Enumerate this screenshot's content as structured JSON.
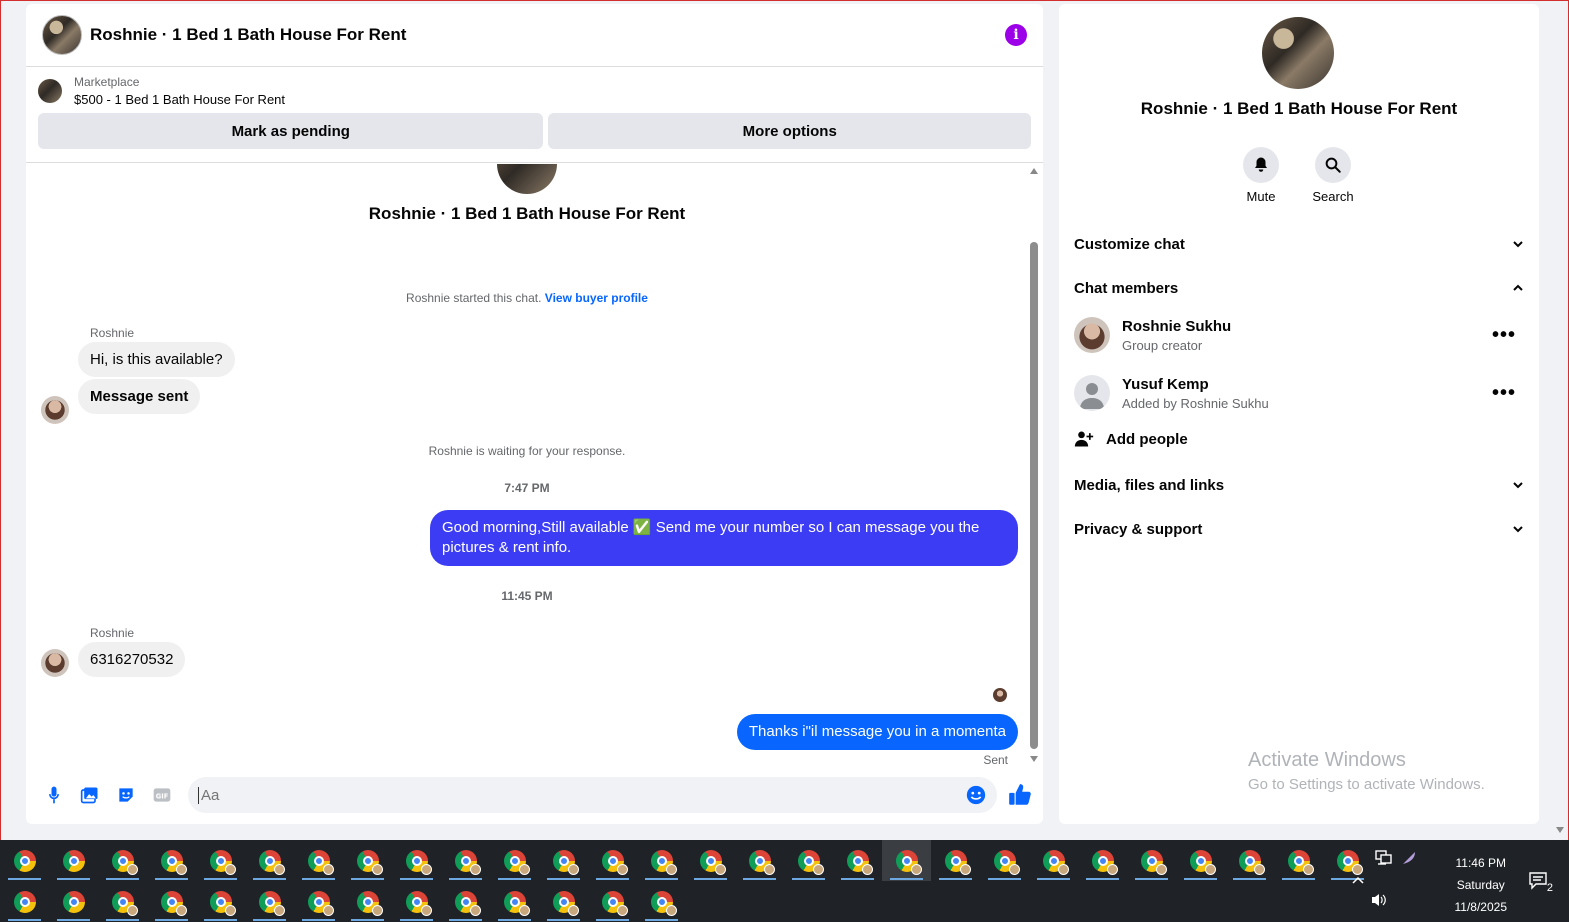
{
  "chat": {
    "header_title": "Roshnie · 1 Bed 1 Bath House For Rent",
    "info_icon": "info-icon",
    "marketplace": {
      "source": "Marketplace",
      "item": "$500 - 1 Bed 1 Bath House For Rent",
      "mark_pending": "Mark as pending",
      "more_options": "More options"
    },
    "convo_title": "Roshnie · 1 Bed 1 Bath House For Rent",
    "started": "Roshnie started this chat.",
    "view_profile": "View buyer profile",
    "messages": [
      {
        "sender": "Roshnie",
        "text": "Hi, is this available?"
      },
      {
        "text": "Message sent"
      }
    ],
    "waiting": "Roshnie is waiting for your response.",
    "time1": "7:47 PM",
    "out1_line1": "Good morning,Still available ✅ Send me your number so I can message you the",
    "out1_line2": "pictures & rent info.",
    "time2": "11:45 PM",
    "sender2": "Roshnie",
    "in3": "6316270532",
    "out2": "Thanks i\"il message you in a momenta",
    "sent_status": "Sent",
    "composer_placeholder": "Aa"
  },
  "info": {
    "title": "Roshnie · 1 Bed 1 Bath House For Rent",
    "mute": "Mute",
    "search": "Search",
    "customize": "Customize chat",
    "members_header": "Chat members",
    "members": [
      {
        "name": "Roshnie Sukhu",
        "sub": "Group creator"
      },
      {
        "name": "Yusuf Kemp",
        "sub": "Added by Roshnie Sukhu"
      }
    ],
    "add_people": "Add people",
    "media": "Media, files and links",
    "privacy": "Privacy & support"
  },
  "watermark": {
    "line1": "Activate Windows",
    "line2": "Go to Settings to activate Windows."
  },
  "taskbar": {
    "time": "11:46 PM",
    "day": "Saturday",
    "date": "11/8/2025",
    "notifications": "2"
  },
  "colors": {
    "accent": "#0866ff",
    "outgoing_bubble": "#3c3cf5",
    "info_icon": "#9b00e8"
  }
}
